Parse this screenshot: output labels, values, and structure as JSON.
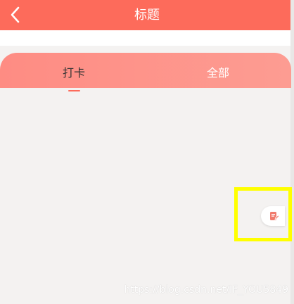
{
  "header": {
    "title": "标题",
    "back_icon": "chevron-left-icon"
  },
  "tabs": [
    {
      "label": "打卡",
      "active": true
    },
    {
      "label": "全部",
      "active": false
    }
  ],
  "float_button": {
    "icon": "edit-note-icon"
  },
  "watermark": "https://blog.csdn.net/IF_YOU5849",
  "colors": {
    "header": "#fd6b5b",
    "tabs_panel": "#fe8c83",
    "background": "#f4f2f1",
    "indicator": "#fd6b5b",
    "highlight": "#ffff00"
  }
}
